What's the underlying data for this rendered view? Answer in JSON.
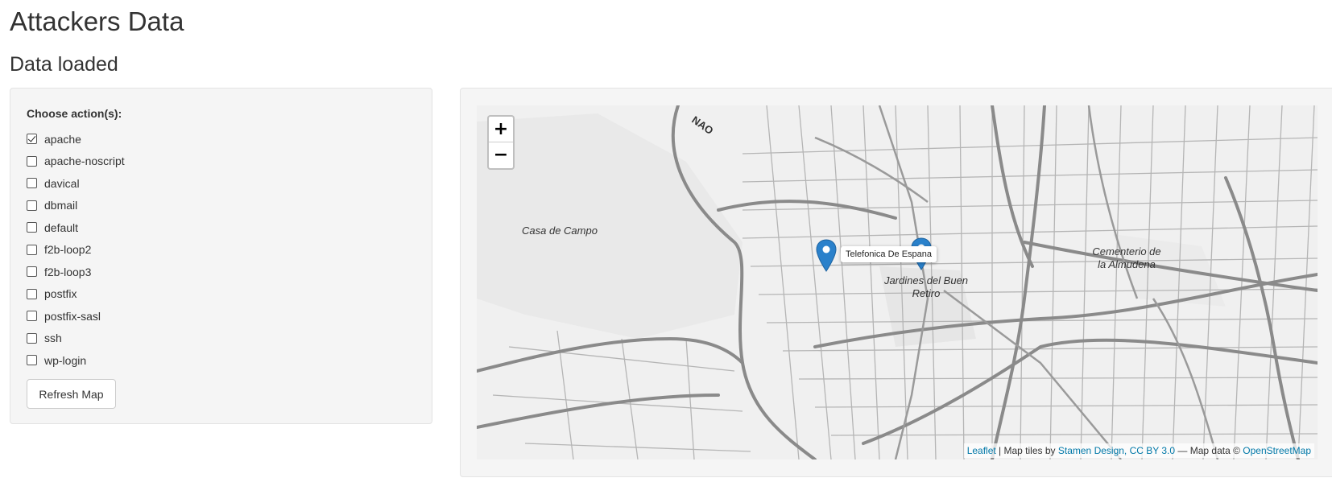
{
  "header": {
    "title": "Attackers Data",
    "subtitle": "Data loaded"
  },
  "sidebar": {
    "group_label": "Choose action(s):",
    "actions": [
      {
        "label": "apache",
        "checked": true
      },
      {
        "label": "apache-noscript",
        "checked": false
      },
      {
        "label": "davical",
        "checked": false
      },
      {
        "label": "dbmail",
        "checked": false
      },
      {
        "label": "default",
        "checked": false
      },
      {
        "label": "f2b-loop2",
        "checked": false
      },
      {
        "label": "f2b-loop3",
        "checked": false
      },
      {
        "label": "postfix",
        "checked": false
      },
      {
        "label": "postfix-sasl",
        "checked": false
      },
      {
        "label": "ssh",
        "checked": false
      },
      {
        "label": "wp-login",
        "checked": false
      }
    ],
    "refresh_label": "Refresh Map"
  },
  "map": {
    "zoom_in_label": "+",
    "zoom_out_label": "−",
    "labels": {
      "casa_de_campo": "Casa de Campo",
      "jardines": "Jardines del Buen Retiro",
      "cementerio": "Cementerio de la Almudena",
      "road_top": "NAO"
    },
    "markers": [
      {
        "name": "Telefonica De Espana",
        "icon": "map-pin-icon"
      },
      {
        "name": "Telefonica De Espana",
        "icon": "map-pin-icon"
      }
    ],
    "popup_text": "Telefonica De Espana",
    "attribution": {
      "leaflet": "Leaflet",
      "sep1": " | Map tiles by ",
      "stamen": "Stamen Design, CC BY 3.0",
      "sep2": " — Map data © ",
      "osm": "OpenStreetMap"
    },
    "colors": {
      "marker": "#2a81cb",
      "link": "#0078a8",
      "road": "#8a8a8a",
      "background": "#f0f0f0"
    }
  }
}
